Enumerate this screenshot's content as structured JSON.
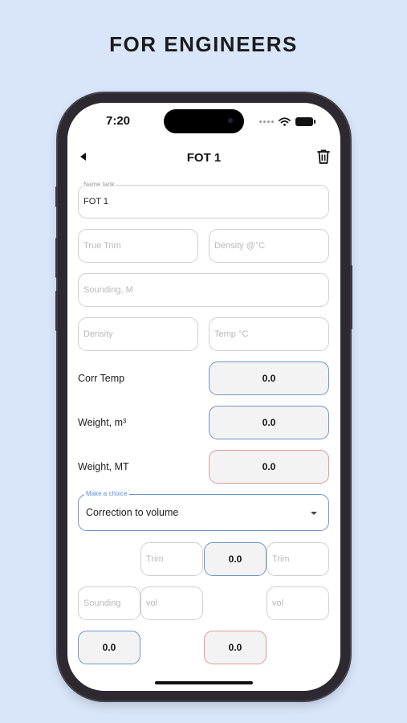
{
  "promo": {
    "title": "FOR ENGINEERS"
  },
  "status": {
    "time": "7:20"
  },
  "nav": {
    "title": "FOT 1"
  },
  "form": {
    "name_tank": {
      "label": "Name tank",
      "value": "FOT 1"
    },
    "true_trim": {
      "placeholder": "True Trim"
    },
    "density_at": {
      "placeholder": "Density @°C"
    },
    "sounding_m": {
      "placeholder": "Sounding, M"
    },
    "density": {
      "placeholder": "Density"
    },
    "temp": {
      "placeholder": "Temp °C"
    }
  },
  "results": {
    "corr_temp": {
      "label": "Corr Temp",
      "value": "0.0"
    },
    "weight_m3": {
      "label": "Weight, m³",
      "value": "0.0"
    },
    "weight_mt": {
      "label": "Weight, MT",
      "value": "0.0"
    }
  },
  "choice": {
    "label": "Make a choice",
    "selected": "Correction to volume"
  },
  "correction": {
    "trim_left": "Trim",
    "trim_result": "0.0",
    "trim_right": "Trim",
    "sounding": "Sounding",
    "vol_left": "vol",
    "vol_right": "vol",
    "result_left": "0.0",
    "result_right": "0.0"
  },
  "colors": {
    "accent_blue": "#6f94c9",
    "accent_red": "#e09a9a",
    "background": "#d9e6fa"
  }
}
